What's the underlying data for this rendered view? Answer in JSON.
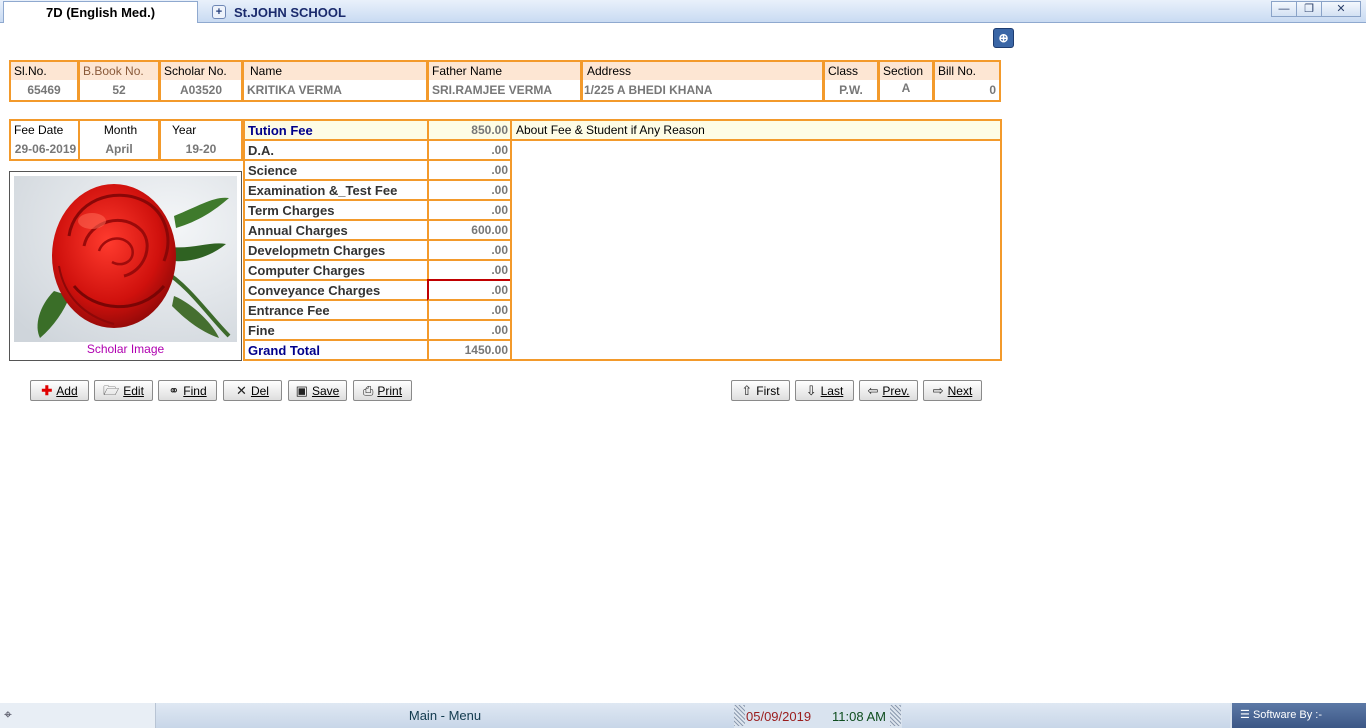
{
  "tabs": [
    {
      "label": "7D (English Med.)",
      "active": true
    },
    {
      "label": "St.JOHN SCHOOL",
      "active": false
    }
  ],
  "window_controls": {
    "minimize": "—",
    "restore": "❐",
    "close": "✕"
  },
  "student": {
    "headers": {
      "sl_no": "Sl.No.",
      "bbook_no": "B.Book No.",
      "scholar_no": "Scholar No.",
      "name": "Name",
      "father_name": "Father Name",
      "address": "Address",
      "class": "Class",
      "section": "Section",
      "bill_no": "Bill No."
    },
    "values": {
      "sl_no": "65469",
      "bbook_no": "52",
      "scholar_no": "A03520",
      "name": "KRITIKA VERMA",
      "father_name": "SRI.RAMJEE VERMA",
      "address": "1/225 A BHEDI KHANA",
      "class": "P.W.",
      "section": "A",
      "bill_no": "0"
    }
  },
  "fee_date": {
    "headers": {
      "date": "Fee Date",
      "month": "Month",
      "year": "Year"
    },
    "values": {
      "date": "29-06-2019",
      "month": "April",
      "year": "19-20"
    }
  },
  "photo": {
    "caption": "Scholar Image",
    "icon": "rose-photo"
  },
  "fees": [
    {
      "label": "Tution Fee",
      "value": "850.00"
    },
    {
      "label": "D.A.",
      "value": ".00"
    },
    {
      "label": "Science",
      "value": ".00"
    },
    {
      "label": "Examination &_Test Fee",
      "value": ".00"
    },
    {
      "label": "Term Charges",
      "value": ".00"
    },
    {
      "label": "Annual Charges",
      "value": "600.00"
    },
    {
      "label": "Developmetn Charges",
      "value": ".00"
    },
    {
      "label": "Computer Charges",
      "value": ".00"
    },
    {
      "label": "Conveyance Charges",
      "value": ".00"
    },
    {
      "label": "Entrance Fee",
      "value": ".00"
    },
    {
      "label": "Fine",
      "value": ".00"
    },
    {
      "label": "Grand Total",
      "value": "1450.00"
    }
  ],
  "remarks": {
    "label": "About Fee & Student if Any Reason",
    "value": ""
  },
  "toolbar": {
    "add": "Add",
    "edit": "Edit",
    "find": "Find",
    "del": "Del",
    "save": "Save",
    "print": "Print",
    "first": "First",
    "last": "Last",
    "prev": "Prev.",
    "next": "Next"
  },
  "statusbar": {
    "main_menu": "Main - Menu",
    "date": "05/09/2019",
    "time": "11:08 AM",
    "software_by": "Software By :-"
  },
  "colors": {
    "accent_border": "#f39a2b",
    "header_fill": "#fde6d3",
    "highlight_text": "#00008b",
    "caption": "#b000b0"
  }
}
